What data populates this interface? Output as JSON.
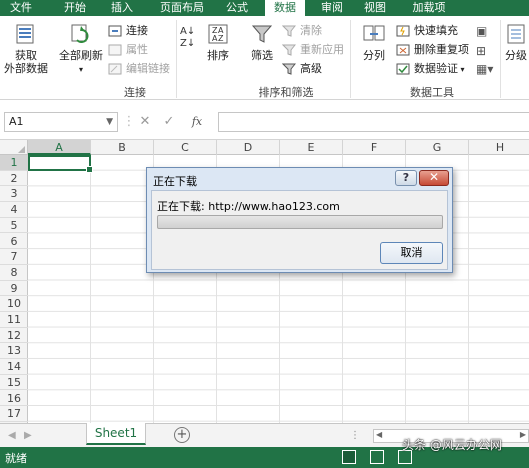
{
  "tabs": [
    {
      "label": "文件"
    },
    {
      "label": "开始"
    },
    {
      "label": "插入"
    },
    {
      "label": "页面布局"
    },
    {
      "label": "公式"
    },
    {
      "label": "数据",
      "active": true
    },
    {
      "label": "审阅"
    },
    {
      "label": "视图"
    },
    {
      "label": "加载项"
    }
  ],
  "ribbon": {
    "get_external": {
      "line1": "获取",
      "line2": "外部数据"
    },
    "refresh_all": {
      "label": "全部刷新"
    },
    "connections": {
      "connect": "连接",
      "properties": "属性",
      "edit_links": "编辑链接",
      "group": "连接"
    },
    "sort_filter": {
      "sort": "排序",
      "filter": "筛选",
      "clear": "清除",
      "reapply": "重新应用",
      "advanced": "高级",
      "group": "排序和筛选"
    },
    "data_tools": {
      "text_to_columns": "分列",
      "flash_fill": "快速填充",
      "remove_dups": "删除重复项",
      "validation": "数据验证",
      "group": "数据工具"
    },
    "outline": {
      "group_label": "分级"
    }
  },
  "formula_bar": {
    "name_box": "A1",
    "fx": "fx"
  },
  "grid": {
    "columns": [
      "A",
      "B",
      "C",
      "D",
      "E",
      "F",
      "G",
      "H"
    ],
    "rows": [
      "1",
      "2",
      "3",
      "4",
      "5",
      "6",
      "7",
      "8",
      "9",
      "10",
      "11",
      "12",
      "13",
      "14",
      "15",
      "16",
      "17"
    ]
  },
  "sheets": {
    "tab": "Sheet1"
  },
  "status": {
    "ready": "就绪"
  },
  "dialog": {
    "title": "正在下载",
    "label": "正在下载:",
    "url": "http://www.hao123.com",
    "cancel": "取消",
    "help": "?",
    "progress": 0.0
  },
  "watermark": "头条 @风云办公网",
  "colors": {
    "excel_green": "#217346",
    "progress_green": "#3cb043"
  }
}
